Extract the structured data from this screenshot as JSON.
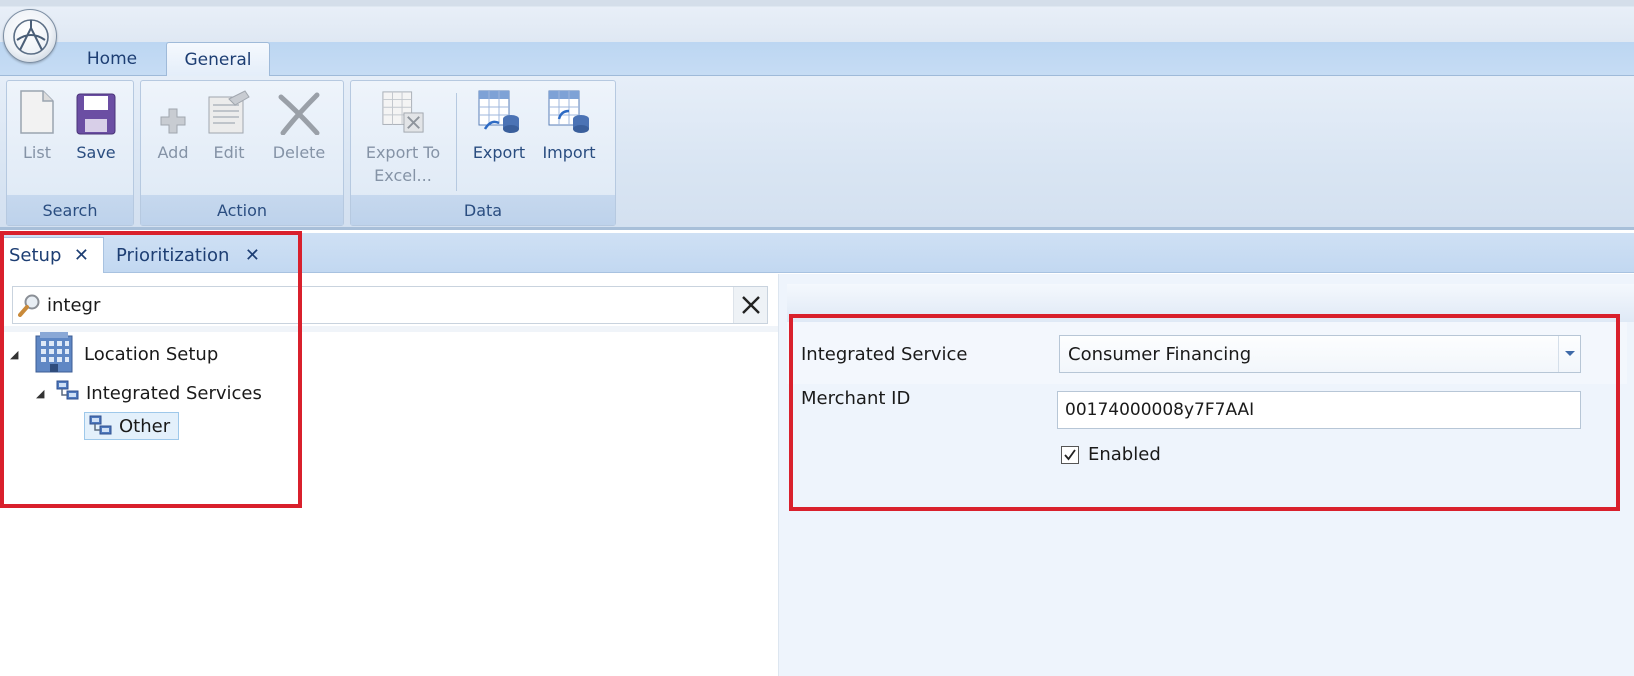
{
  "ribbon": {
    "tabs": [
      {
        "label": "Home"
      },
      {
        "label": "General"
      }
    ],
    "groups": {
      "search": {
        "label": "Search",
        "list": "List",
        "save": "Save"
      },
      "action": {
        "label": "Action",
        "add": "Add",
        "edit": "Edit",
        "delete": "Delete"
      },
      "data": {
        "label": "Data",
        "export_to_excel_1": "Export To",
        "export_to_excel_2": "Excel...",
        "export": "Export",
        "import": "Import"
      }
    }
  },
  "doc_tabs": [
    {
      "label": "Setup",
      "close": "✕"
    },
    {
      "label": "Prioritization",
      "close": "✕"
    }
  ],
  "search": {
    "value": "integr"
  },
  "tree": {
    "root": "Location Setup",
    "child": "Integrated Services",
    "leaf": "Other"
  },
  "form": {
    "integrated_service_label": "Integrated Service",
    "integrated_service_value": "Consumer Financing",
    "merchant_id_label": "Merchant ID",
    "merchant_id_value": "00174000008y7F7AAI",
    "enabled_label": "Enabled"
  },
  "colors": {
    "accent": "#1d3e73",
    "highlight": "#d9202c"
  }
}
